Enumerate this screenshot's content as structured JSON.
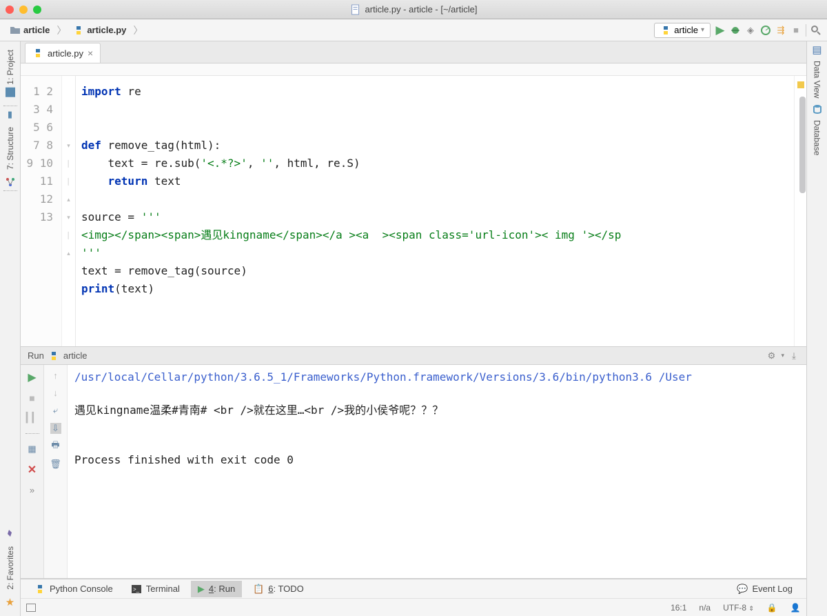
{
  "window": {
    "title": "article.py - article - [~/article]"
  },
  "breadcrumb": {
    "project": "article",
    "file": "article.py"
  },
  "runConfig": {
    "name": "article"
  },
  "leftrail": {
    "project": "1: Project",
    "structure": "7: Structure",
    "favorites": "2: Favorites"
  },
  "rightrail": {
    "dataview": "Data View",
    "database": "Database"
  },
  "tab": {
    "name": "article.py"
  },
  "code": {
    "lines": [
      "1",
      "2",
      "3",
      "4",
      "5",
      "6",
      "7",
      "8",
      "9",
      "10",
      "11",
      "12",
      "13"
    ],
    "l1a": "import",
    "l1b": " re",
    "l4a": "def",
    "l4b": " remove_tag(html):",
    "l5a": "    text = re.sub(",
    "l5b": "'<.*?>'",
    "l5c": ", ",
    "l5d": "''",
    "l5e": ", html, re.S)",
    "l6a": "    ",
    "l6b": "return",
    "l6c": " text",
    "l8a": "source = ",
    "l8b": "'''",
    "l9": "<img></span><span>遇见kingname</span></a ><a  ><span class='url-icon'>< img '></sp",
    "l10": "'''",
    "l11": "text = remove_tag(source)",
    "l12a": "print",
    "l12b": "(text)"
  },
  "runpanel": {
    "title": "Run",
    "config": "article",
    "path": "/usr/local/Cellar/python/3.6.5_1/Frameworks/Python.framework/Versions/3.6/bin/python3.6 /User",
    "out1": "遇见kingname温柔#青南# <br />就在这里…<br />我的小侯爷呢？？？",
    "out2": "Process finished with exit code 0"
  },
  "bottombar": {
    "console": "Python Console",
    "terminal": "Terminal",
    "run": "4: Run",
    "todo": "6: TODO",
    "eventlog": "Event Log"
  },
  "status": {
    "pos": "16:1",
    "ins": "n/a",
    "enc": "UTF-8"
  }
}
